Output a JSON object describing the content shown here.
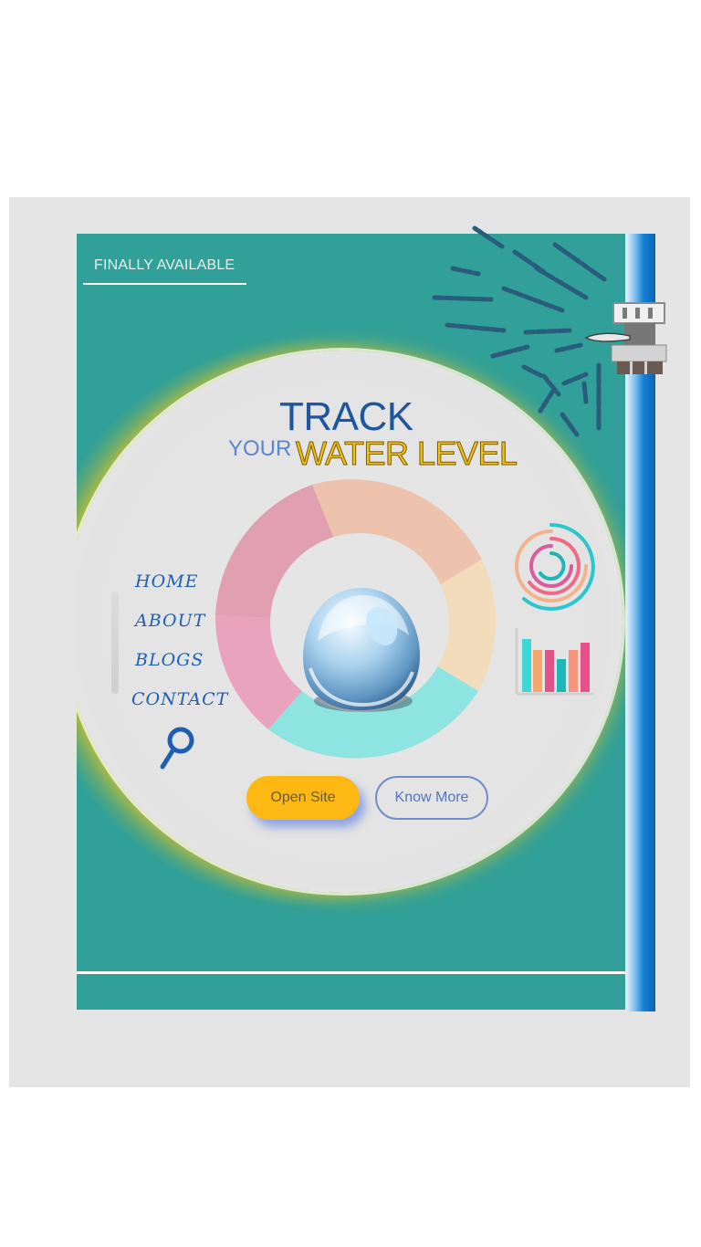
{
  "badge": {
    "label": "FINALLY AVAILABLE"
  },
  "headline": {
    "line1": "TRACK",
    "prefix": "YOUR",
    "highlight": "WATER LEVEL"
  },
  "nav": {
    "items": [
      "HOME",
      "ABOUT",
      "BLOGS",
      "CONTACT"
    ]
  },
  "buttons": {
    "open_site": "Open Site",
    "know_more": "Know More"
  },
  "colors": {
    "screen": "#31a098",
    "title_blue": "#1e56a0",
    "title_yellow": "#f1c316",
    "nav_blue": "#1f5fb2",
    "primary_button": "#fdb813",
    "pipe_blue": "#1481d6",
    "donut_segments": [
      "#eec3ad",
      "#f3dcbb",
      "#8ee4e0",
      "#eaa3bd",
      "#e19fb2"
    ]
  },
  "icons": [
    "search-icon",
    "water-drop-icon",
    "sprinkler-icon",
    "ring-chart-icon",
    "bar-chart-icon"
  ]
}
